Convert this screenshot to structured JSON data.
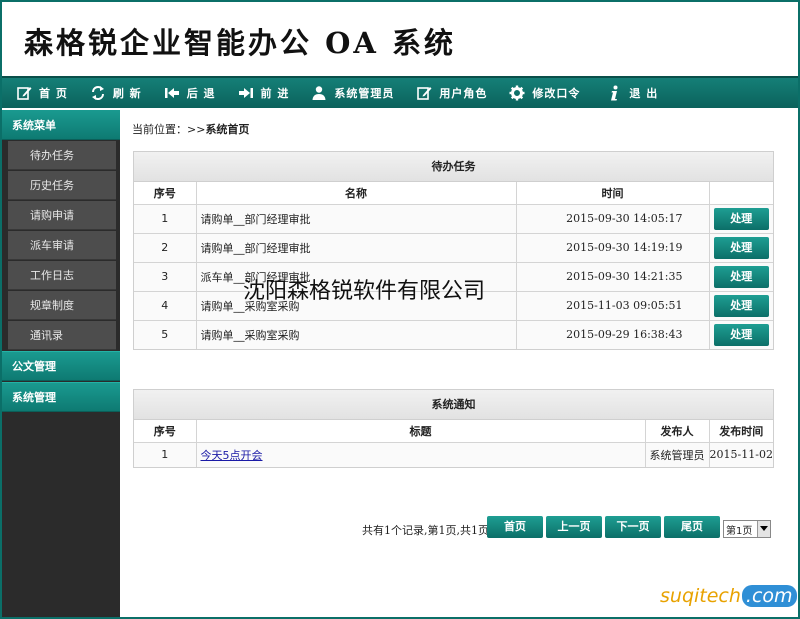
{
  "header": {
    "title": "森格锐企业智能办公 OA 系统"
  },
  "toolbar": [
    {
      "label": "首 页",
      "icon": "edit-icon"
    },
    {
      "label": "刷 新",
      "icon": "refresh-icon"
    },
    {
      "label": "后 退",
      "icon": "back-icon"
    },
    {
      "label": "前 进",
      "icon": "forward-icon"
    },
    {
      "label": "系统管理员",
      "icon": "user-icon"
    },
    {
      "label": "用户角色",
      "icon": "edit-icon"
    },
    {
      "label": "修改口令",
      "icon": "gear-icon"
    },
    {
      "label": "退 出",
      "icon": "info-icon"
    }
  ],
  "sidebar": {
    "menu_title": "系统菜单",
    "items": [
      "待办任务",
      "历史任务",
      "请购申请",
      "派车审请",
      "工作日志",
      "规章制度",
      "通讯录"
    ],
    "sections": [
      "公文管理",
      "系统管理"
    ]
  },
  "breadcrumb": {
    "prefix": "当前位置：>>",
    "current": "系统首页"
  },
  "tasks": {
    "title": "待办任务",
    "columns": [
      "序号",
      "名称",
      "时间",
      ""
    ],
    "action_label": "处理",
    "rows": [
      {
        "no": "1",
        "name": "请购单__部门经理审批",
        "time": "2015-09-30 14:05:17"
      },
      {
        "no": "2",
        "name": "请购单__部门经理审批",
        "time": "2015-09-30 14:19:19"
      },
      {
        "no": "3",
        "name": "派车单__部门经理审批",
        "time": "2015-09-30 14:21:35"
      },
      {
        "no": "4",
        "name": "请购单__采购室采购",
        "time": "2015-11-03 09:05:51"
      },
      {
        "no": "5",
        "name": "请购单__采购室采购",
        "time": "2015-09-29 16:38:43"
      }
    ]
  },
  "notices": {
    "title": "系统通知",
    "columns": [
      "序号",
      "标题",
      "发布人",
      "发布时间"
    ],
    "rows": [
      {
        "no": "1",
        "title": "今天5点开会",
        "publisher": "系统管理员",
        "date": "2015-11-02"
      }
    ]
  },
  "watermark": "沈阳森格锐软件有限公司",
  "pager": {
    "info": "共有1个记录,第1页,共1页",
    "first": "首页",
    "prev": "上一页",
    "next": "下一页",
    "last": "尾页",
    "selected": "第1页"
  },
  "logo": {
    "part1": "suqitech",
    "part2": ".com"
  },
  "colors": {
    "accent": "#0e7a72",
    "sidebar_bg": "#2b2b2b",
    "link": "#1a1aa6"
  }
}
